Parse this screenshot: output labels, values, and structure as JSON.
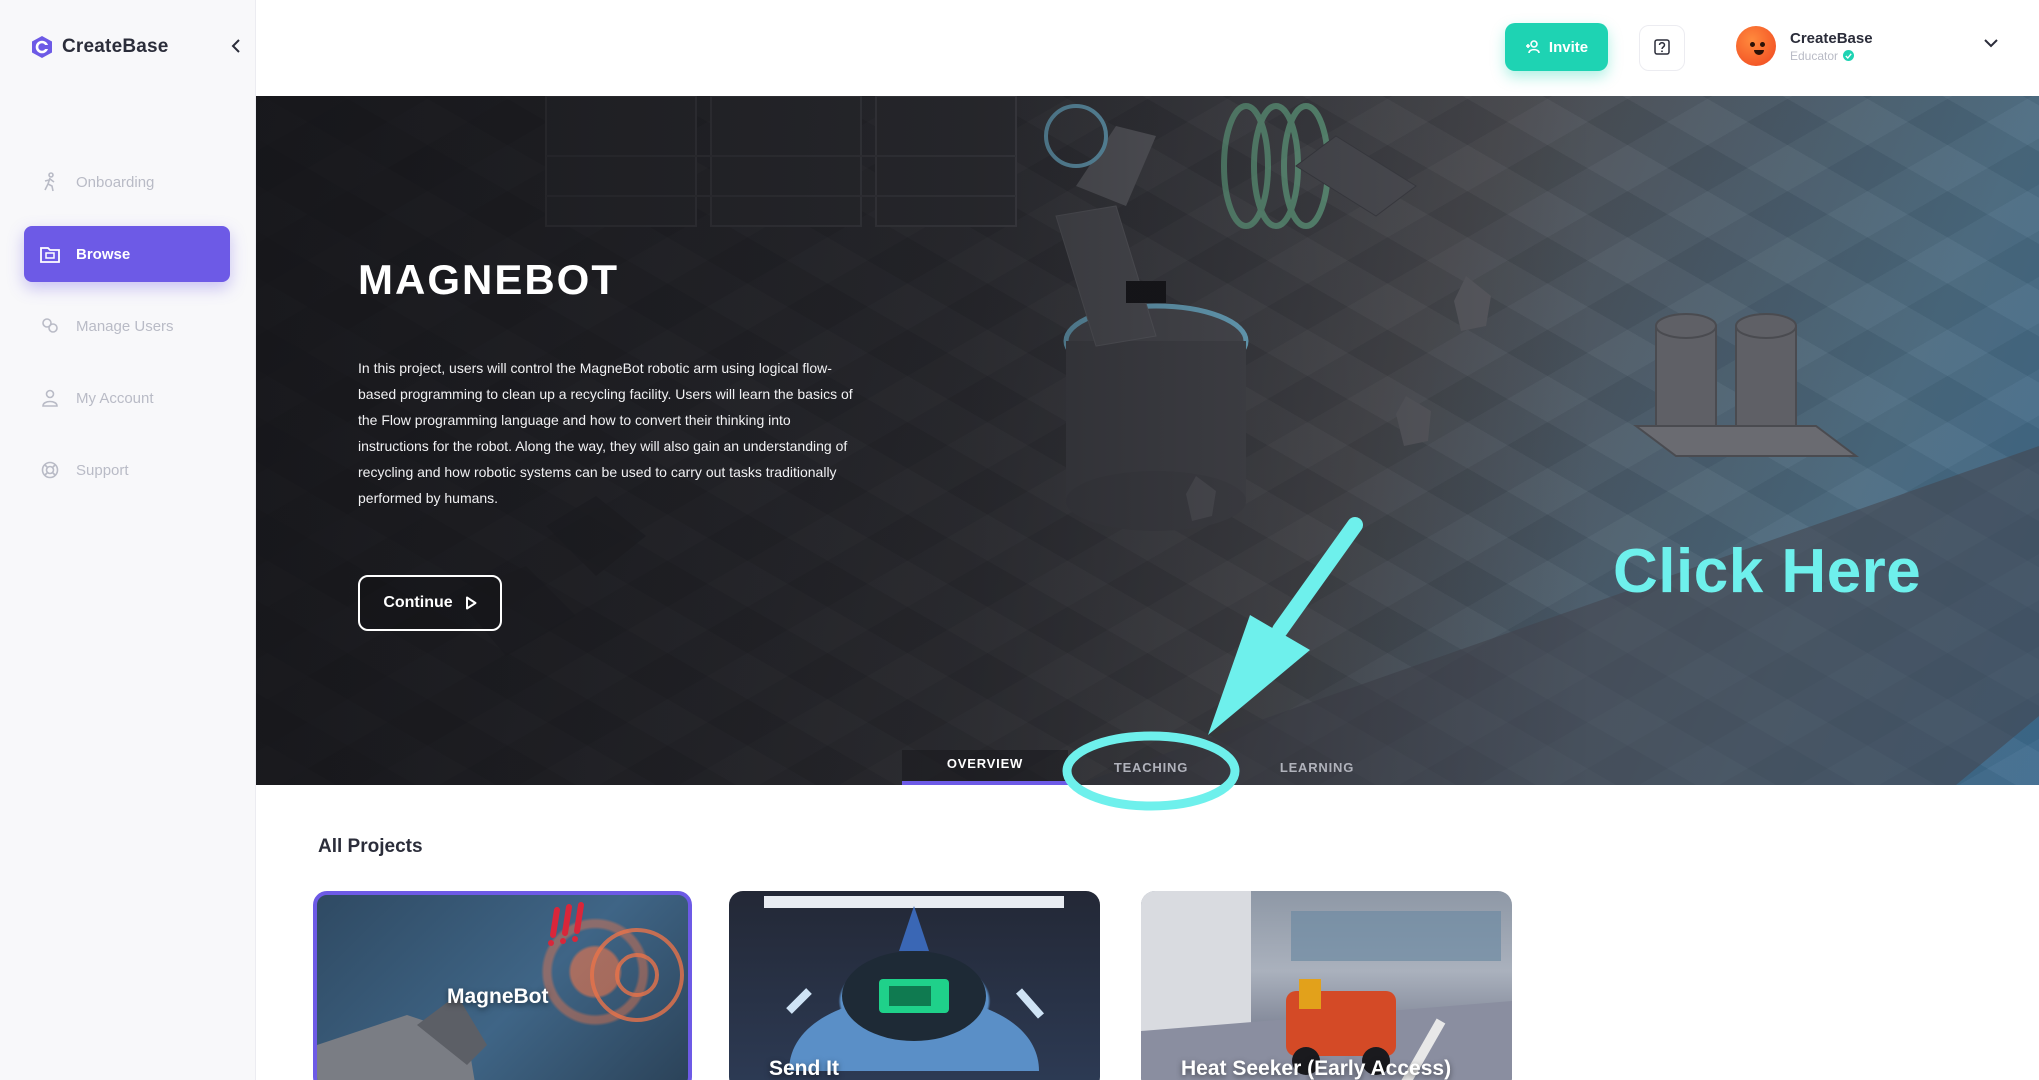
{
  "brand": {
    "name": "CreateBase"
  },
  "sidebar": {
    "items": [
      {
        "label": "Onboarding",
        "icon": "walking-person-icon",
        "active": false
      },
      {
        "label": "Browse",
        "icon": "folder-icon",
        "active": true
      },
      {
        "label": "Manage Users",
        "icon": "users-icon",
        "active": false
      },
      {
        "label": "My Account",
        "icon": "user-icon",
        "active": false
      },
      {
        "label": "Support",
        "icon": "lifebuoy-icon",
        "active": false
      }
    ]
  },
  "header": {
    "invite_label": "Invite",
    "user": {
      "name": "CreateBase",
      "role": "Educator"
    }
  },
  "hero": {
    "title": "MAGNEBOT",
    "description": "In this project, users will control the MagneBot robotic arm using logical flow-based programming to clean up a recycling facility. Users will learn the basics of the Flow programming language and how to convert their thinking into instructions for the robot. Along the way, they will also gain an understanding of recycling and how robotic systems can be used to carry out tasks traditionally performed by humans.",
    "continue_label": "Continue",
    "tabs": [
      "OVERVIEW",
      "TEACHING",
      "LEARNING"
    ],
    "active_tab": "OVERVIEW"
  },
  "annotation": {
    "text": "Click Here",
    "color": "#6ef0ec"
  },
  "projects": {
    "title": "All Projects",
    "cards": [
      {
        "name": "MagneBot",
        "selected": true
      },
      {
        "name": "Send It",
        "selected": false
      },
      {
        "name": "Heat Seeker (Early Access)",
        "selected": false
      }
    ]
  },
  "colors": {
    "accent": "#6d5ae6",
    "invite": "#1ed3b3"
  }
}
